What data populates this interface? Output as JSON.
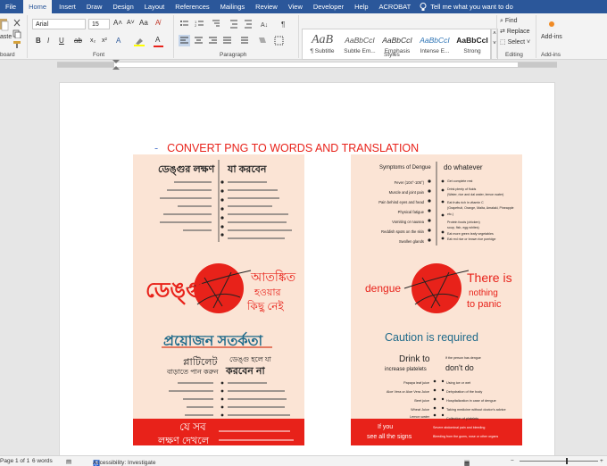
{
  "tabs": [
    "File",
    "Home",
    "Insert",
    "Draw",
    "Design",
    "Layout",
    "References",
    "Mailings",
    "Review",
    "View",
    "Developer",
    "Help",
    "ACROBAT"
  ],
  "active_tab": "Home",
  "tell_me": "Tell me what you want to do",
  "ribbon": {
    "clipboard": {
      "paste": "aste",
      "label": "board"
    },
    "font": {
      "name": "Arial",
      "size": "15",
      "label": "Font",
      "bold": "B",
      "italic": "I",
      "underline": "U"
    },
    "paragraph": {
      "label": "Paragraph"
    },
    "styles": {
      "label": "Styles",
      "items": [
        {
          "sample": "AaB",
          "name": "¶ Subtitle"
        },
        {
          "sample": "AaBbCcI",
          "name": "Subtle Em..."
        },
        {
          "sample": "AaBbCcI",
          "name": "Emphasis"
        },
        {
          "sample": "AaBbCcI",
          "name": "Intense E..."
        },
        {
          "sample": "AaBbCcI",
          "name": "Strong"
        }
      ]
    },
    "editing": {
      "find": "Find",
      "replace": "Replace",
      "select": "Select",
      "label": "Editing"
    },
    "addins": {
      "button": "Add-ins",
      "label": "Add-ins"
    }
  },
  "document": {
    "heading": "CONVERT  PNG TO WORDS AND TRANSLATION",
    "poster_bn": {
      "symptoms_title": "ডেঙ্গুর লক্ষণ",
      "todo_title": "যা করবেন",
      "main_left": "ডেঙ্গু",
      "main_right_1": "আতঙ্কিত",
      "main_right_2": "হওয়ার",
      "main_right_3": "কিছু নেই",
      "caution": "প্রয়োজন সতর্কতা",
      "platelet_1": "প্লাটিলেট",
      "platelet_2": "বাড়াতে পান করুন",
      "dont_1": "ডেঙ্গু হলে যা",
      "dont_2": "করবেন না",
      "bottom_1": "যে সব",
      "bottom_2": "লক্ষণ দেখলে"
    },
    "poster_en": {
      "symptoms_title": "Symptoms of Dengue",
      "todo_title": "do whatever",
      "symptoms": [
        "Fever (104°-105°)",
        "Muscle and joint pain",
        "Pain behind eyes and head",
        "Physical fatigue",
        "Vomiting or nausea",
        "Reddish spots on the skin",
        "Swollen glands"
      ],
      "todo": [
        "Get complete rest",
        "Drink plenty of fluids",
        "(Water, rice and dal water, lemon water)",
        "Eat fruits rich in vitamin C",
        "(Grapefruit, Orange, Malta, Amalaki, Pineapple etc.)",
        "Protein foods (chicken)",
        "soup, fish, egg whites)",
        "Eat more green leafy vegetables",
        "Eat red rice or brown rice porridge"
      ],
      "main_left": "dengue",
      "main_right_1": "There is",
      "main_right_2": "nothing",
      "main_right_3": "to panic",
      "caution": "Caution is required",
      "drink_1": "Drink to",
      "drink_2": "increase platelets",
      "dont_title": "don't do",
      "dont_small": "If the person has dengue",
      "juices": [
        "Papaya leaf juice",
        "Aloe Vera or Aloe Vera Juice",
        "Beet juice",
        "Wheat Juice",
        "Lemon water"
      ],
      "donts": [
        "Using ice or wet",
        "Dehydration of the body",
        "Hospitalization in case of dengue",
        "Taking medicine without doctor's advice",
        "Collection of platelets"
      ],
      "bottom_1": "If you",
      "bottom_2": "see all the signs",
      "bottom_right_1": "Severe abdominal pain and bleeding",
      "bottom_right_2": "Bleeding from the gums, nose or other organs"
    }
  },
  "status": {
    "page": "Page 1 of 1",
    "words": "6 words",
    "accessibility": "Accessibility: Investigate"
  },
  "colors": {
    "accent": "#2b579a",
    "red": "#e8221a",
    "poster_bg": "#fbe4d5",
    "caution_blue": "#1f6a8a"
  }
}
